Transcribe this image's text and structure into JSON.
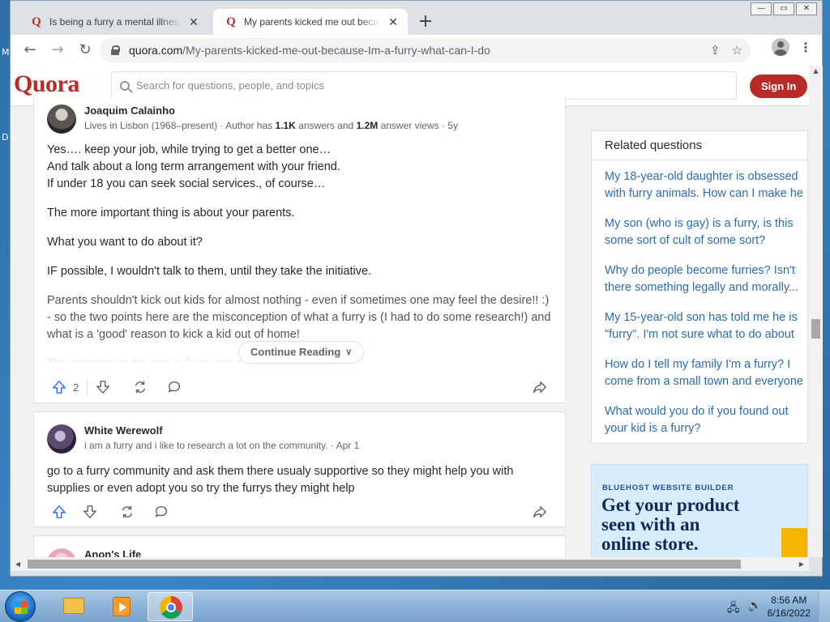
{
  "desktop": {
    "side_letters": [
      "M",
      "D"
    ]
  },
  "window": {
    "caption_buttons": [
      "—",
      "▭",
      "✕"
    ]
  },
  "tabs": [
    {
      "title": "Is being a furry a mental illness?",
      "active": false
    },
    {
      "title": "My parents kicked me out because",
      "active": true
    }
  ],
  "toolbar": {
    "url_host": "quora.com",
    "url_path": "/My-parents-kicked-me-out-because-Im-a-furry-what-can-I-do"
  },
  "quora": {
    "logo": "Quora",
    "search_placeholder": "Search for questions, people, and topics",
    "signin_label": "Sign In"
  },
  "answers": [
    {
      "author": "Joaquim Calainho",
      "cred_prefix": "Lives in Lisbon (1968–present) · Author has ",
      "cred_answers": "1.1K",
      "cred_mid": " answers and ",
      "cred_views": "1.2M",
      "cred_suffix": " answer views · 5y",
      "paragraphs": [
        "Yes…. keep your job, while trying to get a better one…",
        "And talk about a long term arrangement with your friend.",
        "If under 18 you can seek social services., of course…",
        "The more important thing is about your parents.",
        "What you want to do about it?",
        "IF possible, I wouldn't talk to them, until they take the initiative.",
        "Parents shouldn't kick out kids for almost nothing - even if sometimes one may feel the desire!! :) - so the two points here are the misconception of what a furry is (I had to do some research!) and what is a 'good' reason to kick a kid out of home!",
        "The question in the end is if you are ab..."
      ],
      "continue_label": "Continue Reading",
      "upvotes": "2"
    },
    {
      "author": "White Werewolf",
      "cred": "i am a furry and i like to research a lot on the community. · Apr 1",
      "text": "go to a furry community and ask them there usualy supportive so they might help you with supplies or even adopt you so try the furrys they might help"
    },
    {
      "author": "Anon's Life"
    }
  ],
  "related": {
    "title": "Related questions",
    "items": [
      [
        "My 18-year-old daughter is obsessed",
        "with furry animals. How can I make he"
      ],
      [
        "My son (who is gay) is a furry, is this",
        "some sort of cult of some sort?"
      ],
      [
        "Why do people become furries? Isn't",
        "there something legally and morally..."
      ],
      [
        "My 15-year-old son has told me he is",
        "\"furry\". I'm not sure what to do about"
      ],
      [
        "How do I tell my family I'm a furry? I",
        "come from a small town and everyone"
      ],
      [
        "What would you do if you found out",
        "your kid is a furry?"
      ]
    ]
  },
  "ad": {
    "tag": "BLUEHOST WEBSITE BUILDER",
    "headline_1": "Get your product",
    "headline_2": "seen with an",
    "headline_3": "online store."
  },
  "taskbar": {
    "time": "8:56 AM",
    "date": "6/16/2022"
  },
  "colors": {
    "quora_red": "#b92b27",
    "link_blue": "#2b6dad"
  }
}
